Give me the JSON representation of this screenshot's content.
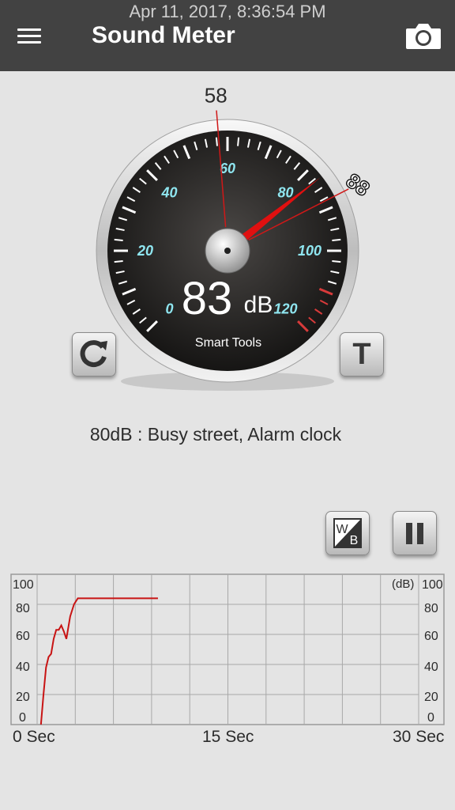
{
  "status": {
    "datetime": "Apr 11, 2017, 8:36:54 PM"
  },
  "header": {
    "title": "Sound Meter",
    "menu_icon": "hamburger-menu-icon",
    "camera_icon": "camera-icon"
  },
  "gauge": {
    "current_db": 83,
    "current_value": "83",
    "unit": "dB",
    "brand": "Smart Tools",
    "max_marker_value": 88,
    "max_marker_label": "88",
    "avg_marker_value": 58,
    "avg_marker_label": "58",
    "scale_min": 0,
    "scale_max": 120,
    "scale_labels": [
      "0",
      "20",
      "40",
      "60",
      "80",
      "100",
      "120"
    ],
    "colors": {
      "face": "#2a2a2a",
      "needle": "#e01010",
      "label": "#8fe6f0",
      "warning": "#d83a3a"
    }
  },
  "buttons": {
    "reset_icon": "refresh-icon",
    "t_label": "T",
    "wb_w": "W",
    "wb_b": "B",
    "pause_icon": "pause-icon"
  },
  "description": "80dB : Busy street, Alarm clock",
  "chart_data": {
    "type": "line",
    "x_label_start": "0 Sec",
    "x_label_mid": "15 Sec",
    "x_label_end": "30 Sec",
    "xlim": [
      0,
      30
    ],
    "ylim": [
      0,
      100
    ],
    "y_ticks": [
      "0",
      "20",
      "40",
      "60",
      "80",
      "100"
    ],
    "unit_label": "(dB)",
    "grid": true,
    "series": [
      {
        "color": "#c81414",
        "x": [
          0.3,
          0.5,
          0.7,
          0.9,
          1.1,
          1.3,
          1.5,
          1.7,
          1.9,
          2.1,
          2.3,
          2.6,
          2.9,
          3.2,
          9.5
        ],
        "y": [
          0,
          20,
          38,
          45,
          47,
          57,
          63,
          63,
          66,
          62,
          57,
          72,
          80,
          84,
          84
        ]
      }
    ]
  }
}
